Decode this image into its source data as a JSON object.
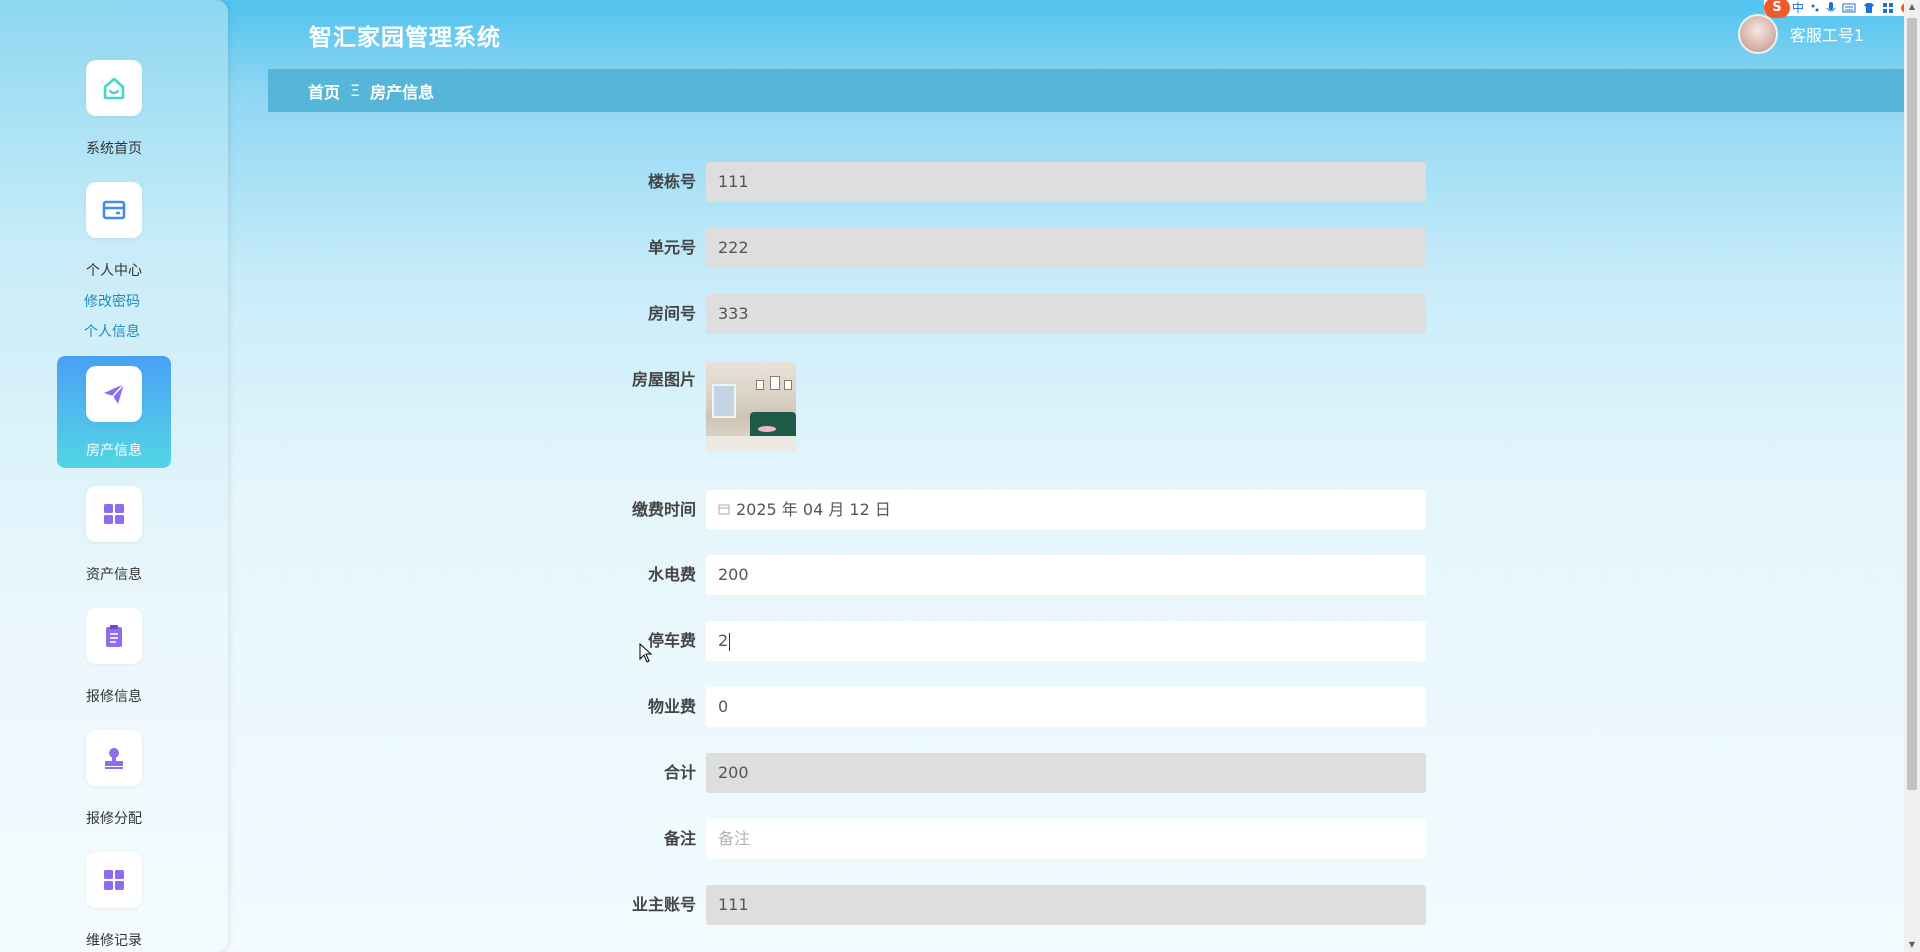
{
  "header": {
    "app_title": "智汇家园管理系统",
    "username": "客服工号1"
  },
  "sidebar": {
    "items": [
      {
        "label": "系统首页",
        "icon": "home-icon"
      },
      {
        "label": "个人中心",
        "icon": "wallet-icon"
      },
      {
        "label": "房产信息",
        "icon": "paper-plane-icon",
        "active": true
      },
      {
        "label": "资产信息",
        "icon": "grid-icon"
      },
      {
        "label": "报修信息",
        "icon": "clipboard-icon"
      },
      {
        "label": "报修分配",
        "icon": "stamp-icon"
      },
      {
        "label": "维修记录",
        "icon": "grid-icon"
      }
    ],
    "sub_links": [
      "修改密码",
      "个人信息"
    ]
  },
  "breadcrumb": {
    "home": "首页",
    "separator": "Ξ",
    "current": "房产信息"
  },
  "form": {
    "building_no": {
      "label": "楼栋号",
      "value": "111"
    },
    "unit_no": {
      "label": "单元号",
      "value": "222"
    },
    "room_no": {
      "label": "房间号",
      "value": "333"
    },
    "house_photo": {
      "label": "房屋图片"
    },
    "pay_time": {
      "label": "缴费时间",
      "value": "2025 年 04 月 12 日"
    },
    "utility_fee": {
      "label": "水电费",
      "value": "200"
    },
    "parking_fee": {
      "label": "停车费",
      "value": "2"
    },
    "property_fee": {
      "label": "物业费",
      "value": "0"
    },
    "total": {
      "label": "合计",
      "value": "200"
    },
    "remark": {
      "label": "备注",
      "placeholder": "备注"
    },
    "owner_account": {
      "label": "业主账号",
      "value": "111"
    }
  },
  "tray": {
    "logo": "S",
    "ime": "中"
  },
  "colors": {
    "sidebar_active_top": "#49a0f5",
    "sidebar_active_bottom": "#53d6e4",
    "breadcrumb_bg": "#56b6da",
    "readonly_field": "#dedede",
    "link": "#1d8db9"
  }
}
